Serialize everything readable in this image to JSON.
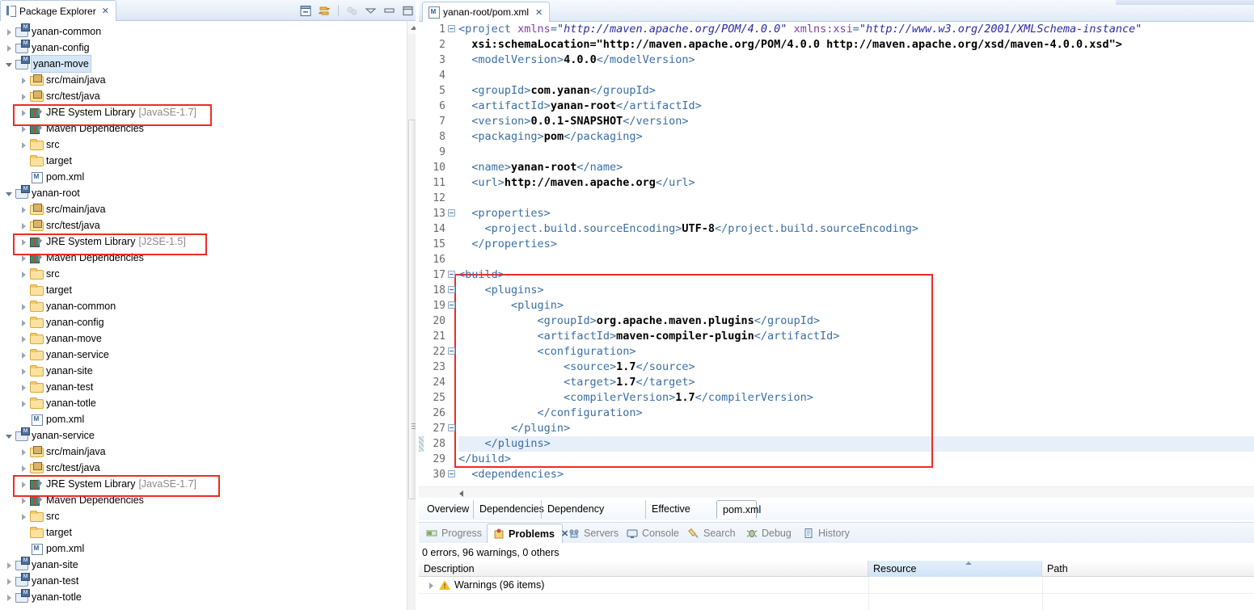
{
  "explorer": {
    "tab_label": "Package Explorer",
    "tab_close": "✕",
    "toolbar": [
      {
        "name": "collapse-all-icon",
        "title": "Collapse All"
      },
      {
        "name": "link-with-editor-icon",
        "title": "Link with Editor"
      },
      {
        "name": "focus-on-active-task-icon",
        "title": "Focus on Active Task"
      },
      {
        "name": "view-menu-icon",
        "title": "View Menu"
      },
      {
        "name": "minimize-icon",
        "title": "Minimize"
      },
      {
        "name": "maximize-icon",
        "title": "Maximize"
      }
    ],
    "tree": [
      {
        "label": "yanan-common",
        "sub": "",
        "depth": 0,
        "icon": "project",
        "arrow": "closed",
        "selected": false
      },
      {
        "label": "yanan-config",
        "sub": "",
        "depth": 0,
        "icon": "project",
        "arrow": "closed",
        "selected": false
      },
      {
        "label": "yanan-move",
        "sub": "",
        "depth": 0,
        "icon": "project",
        "arrow": "open",
        "selected": true
      },
      {
        "label": "src/main/java",
        "sub": "",
        "depth": 1,
        "icon": "srcfolder",
        "arrow": "closed",
        "selected": false
      },
      {
        "label": "src/test/java",
        "sub": "",
        "depth": 1,
        "icon": "srcfolder",
        "arrow": "closed",
        "selected": false
      },
      {
        "label": "JRE System Library",
        "sub": "[JavaSE-1.7]",
        "depth": 1,
        "icon": "library",
        "arrow": "closed",
        "selected": false
      },
      {
        "label": "Maven Dependencies",
        "sub": "",
        "depth": 1,
        "icon": "library",
        "arrow": "closed",
        "selected": false
      },
      {
        "label": "src",
        "sub": "",
        "depth": 1,
        "icon": "folder",
        "arrow": "closed",
        "selected": false
      },
      {
        "label": "target",
        "sub": "",
        "depth": 1,
        "icon": "folder",
        "arrow": "none",
        "selected": false
      },
      {
        "label": "pom.xml",
        "sub": "",
        "depth": 1,
        "icon": "xmlfile",
        "arrow": "none",
        "selected": false
      },
      {
        "label": "yanan-root",
        "sub": "",
        "depth": 0,
        "icon": "project",
        "arrow": "open",
        "selected": false
      },
      {
        "label": "src/main/java",
        "sub": "",
        "depth": 1,
        "icon": "srcfolder",
        "arrow": "closed",
        "selected": false
      },
      {
        "label": "src/test/java",
        "sub": "",
        "depth": 1,
        "icon": "srcfolder",
        "arrow": "closed",
        "selected": false
      },
      {
        "label": "JRE System Library",
        "sub": "[J2SE-1.5]",
        "depth": 1,
        "icon": "library",
        "arrow": "closed",
        "selected": false
      },
      {
        "label": "Maven Dependencies",
        "sub": "",
        "depth": 1,
        "icon": "library",
        "arrow": "closed",
        "selected": false
      },
      {
        "label": "src",
        "sub": "",
        "depth": 1,
        "icon": "folder",
        "arrow": "closed",
        "selected": false
      },
      {
        "label": "target",
        "sub": "",
        "depth": 1,
        "icon": "folder",
        "arrow": "none",
        "selected": false
      },
      {
        "label": "yanan-common",
        "sub": "",
        "depth": 1,
        "icon": "folder",
        "arrow": "closed",
        "selected": false
      },
      {
        "label": "yanan-config",
        "sub": "",
        "depth": 1,
        "icon": "folder",
        "arrow": "closed",
        "selected": false
      },
      {
        "label": "yanan-move",
        "sub": "",
        "depth": 1,
        "icon": "folder",
        "arrow": "closed",
        "selected": false
      },
      {
        "label": "yanan-service",
        "sub": "",
        "depth": 1,
        "icon": "folder",
        "arrow": "closed",
        "selected": false
      },
      {
        "label": "yanan-site",
        "sub": "",
        "depth": 1,
        "icon": "folder",
        "arrow": "closed",
        "selected": false
      },
      {
        "label": "yanan-test",
        "sub": "",
        "depth": 1,
        "icon": "folder",
        "arrow": "closed",
        "selected": false
      },
      {
        "label": "yanan-totle",
        "sub": "",
        "depth": 1,
        "icon": "folder",
        "arrow": "closed",
        "selected": false
      },
      {
        "label": "pom.xml",
        "sub": "",
        "depth": 1,
        "icon": "xmlfile",
        "arrow": "none",
        "selected": false
      },
      {
        "label": "yanan-service",
        "sub": "",
        "depth": 0,
        "icon": "project",
        "arrow": "open",
        "selected": false
      },
      {
        "label": "src/main/java",
        "sub": "",
        "depth": 1,
        "icon": "srcfolder",
        "arrow": "closed",
        "selected": false
      },
      {
        "label": "src/test/java",
        "sub": "",
        "depth": 1,
        "icon": "srcfolder",
        "arrow": "closed",
        "selected": false
      },
      {
        "label": "JRE System Library",
        "sub": "[JavaSE-1.7]",
        "depth": 1,
        "icon": "library",
        "arrow": "closed",
        "selected": false
      },
      {
        "label": "Maven Dependencies",
        "sub": "",
        "depth": 1,
        "icon": "library",
        "arrow": "closed",
        "selected": false
      },
      {
        "label": "src",
        "sub": "",
        "depth": 1,
        "icon": "folder",
        "arrow": "closed",
        "selected": false
      },
      {
        "label": "target",
        "sub": "",
        "depth": 1,
        "icon": "folder",
        "arrow": "none",
        "selected": false
      },
      {
        "label": "pom.xml",
        "sub": "",
        "depth": 1,
        "icon": "xmlfile",
        "arrow": "none",
        "selected": false
      },
      {
        "label": "yanan-site",
        "sub": "",
        "depth": 0,
        "icon": "project",
        "arrow": "closed",
        "selected": false
      },
      {
        "label": "yanan-test",
        "sub": "",
        "depth": 0,
        "icon": "project",
        "arrow": "closed",
        "selected": false
      },
      {
        "label": "yanan-totle",
        "sub": "",
        "depth": 0,
        "icon": "project",
        "arrow": "closed",
        "selected": false
      }
    ],
    "highlight_color": "#ee2b26"
  },
  "editor": {
    "tab_label": "yanan-root/pom.xml",
    "tab_close": "✕",
    "lines": [
      {
        "n": "1",
        "fold": true,
        "indent": 0
      },
      {
        "n": "2",
        "fold": false,
        "indent": 0
      },
      {
        "n": "3",
        "fold": false,
        "indent": 0
      },
      {
        "n": "4",
        "fold": false,
        "indent": 0
      },
      {
        "n": "5",
        "fold": false,
        "indent": 0
      },
      {
        "n": "6",
        "fold": false,
        "indent": 0
      },
      {
        "n": "7",
        "fold": false,
        "indent": 0
      },
      {
        "n": "8",
        "fold": false,
        "indent": 0
      },
      {
        "n": "9",
        "fold": false,
        "indent": 0
      },
      {
        "n": "10",
        "fold": false,
        "indent": 0
      },
      {
        "n": "11",
        "fold": false,
        "indent": 0
      },
      {
        "n": "12",
        "fold": false,
        "indent": 0
      },
      {
        "n": "13",
        "fold": true,
        "indent": 0
      },
      {
        "n": "14",
        "fold": false,
        "indent": 0
      },
      {
        "n": "15",
        "fold": false,
        "indent": 0
      },
      {
        "n": "16",
        "fold": false,
        "indent": 0
      },
      {
        "n": "17",
        "fold": true,
        "indent": 0
      },
      {
        "n": "18",
        "fold": true,
        "indent": 0
      },
      {
        "n": "19",
        "fold": true,
        "indent": 0
      },
      {
        "n": "20",
        "fold": false,
        "indent": 0
      },
      {
        "n": "21",
        "fold": false,
        "indent": 0
      },
      {
        "n": "22",
        "fold": true,
        "indent": 0
      },
      {
        "n": "23",
        "fold": false,
        "indent": 0
      },
      {
        "n": "24",
        "fold": false,
        "indent": 0
      },
      {
        "n": "25",
        "fold": false,
        "indent": 0
      },
      {
        "n": "26",
        "fold": false,
        "indent": 0
      },
      {
        "n": "27",
        "fold": true,
        "indent": 0
      },
      {
        "n": "28",
        "fold": false,
        "indent": 0
      },
      {
        "n": "29",
        "fold": false,
        "indent": 0
      },
      {
        "n": "30",
        "fold": true,
        "indent": 0
      }
    ],
    "source_text": [
      "<project xmlns=\"http://maven.apache.org/POM/4.0.0\" xmlns:xsi=\"http://www.w3.org/2001/XMLSchema-instance\"",
      "  xsi:schemaLocation=\"http://maven.apache.org/POM/4.0.0 http://maven.apache.org/xsd/maven-4.0.0.xsd\">",
      "  <modelVersion>4.0.0</modelVersion>",
      "",
      "  <groupId>com.yanan</groupId>",
      "  <artifactId>yanan-root</artifactId>",
      "  <version>0.0.1-SNAPSHOT</version>",
      "  <packaging>pom</packaging>",
      "",
      "  <name>yanan-root</name>",
      "  <url>http://maven.apache.org</url>",
      "",
      "  <properties>",
      "    <project.build.sourceEncoding>UTF-8</project.build.sourceEncoding>",
      "  </properties>",
      "",
      "<build>",
      "    <plugins>",
      "        <plugin>",
      "            <groupId>org.apache.maven.plugins</groupId>",
      "            <artifactId>maven-compiler-plugin</artifactId>",
      "            <configuration>",
      "                <source>1.7</source>",
      "                <target>1.7</target>",
      "                <compilerVersion>1.7</compilerVersion>",
      "            </configuration>",
      "        </plugin>",
      "    </plugins>",
      "</build>",
      "  <dependencies>"
    ],
    "selected_line": "28",
    "highlight_color": "#ee2b26"
  },
  "page_tabs": [
    {
      "label": "Overview",
      "active": false
    },
    {
      "label": "Dependencies",
      "active": false
    },
    {
      "label": "Dependency Hierarchy",
      "active": false
    },
    {
      "label": "Effective POM",
      "active": false
    },
    {
      "label": "pom.xml",
      "active": true
    }
  ],
  "bottom_tabs": [
    {
      "label": "Progress",
      "icon": "progress-icon",
      "active": false
    },
    {
      "label": "Problems",
      "icon": "problems-icon",
      "active": true
    },
    {
      "label": "Servers",
      "icon": "servers-icon",
      "active": false
    },
    {
      "label": "Console",
      "icon": "console-icon",
      "active": false
    },
    {
      "label": "Search",
      "icon": "search-icon",
      "active": false
    },
    {
      "label": "Debug",
      "icon": "debug-icon",
      "active": false
    },
    {
      "label": "History",
      "icon": "history-icon",
      "active": false
    }
  ],
  "problems": {
    "tab_close": "✕",
    "summary": "0 errors, 96 warnings, 0 others",
    "columns": [
      {
        "label": "Description",
        "sorted": false
      },
      {
        "label": "Resource",
        "sorted": true
      },
      {
        "label": "Path",
        "sorted": false
      }
    ],
    "rows": [
      {
        "description": "Warnings (96 items)",
        "resource": "",
        "path": "",
        "arrow": "closed",
        "icon": "warning-icon"
      }
    ]
  }
}
